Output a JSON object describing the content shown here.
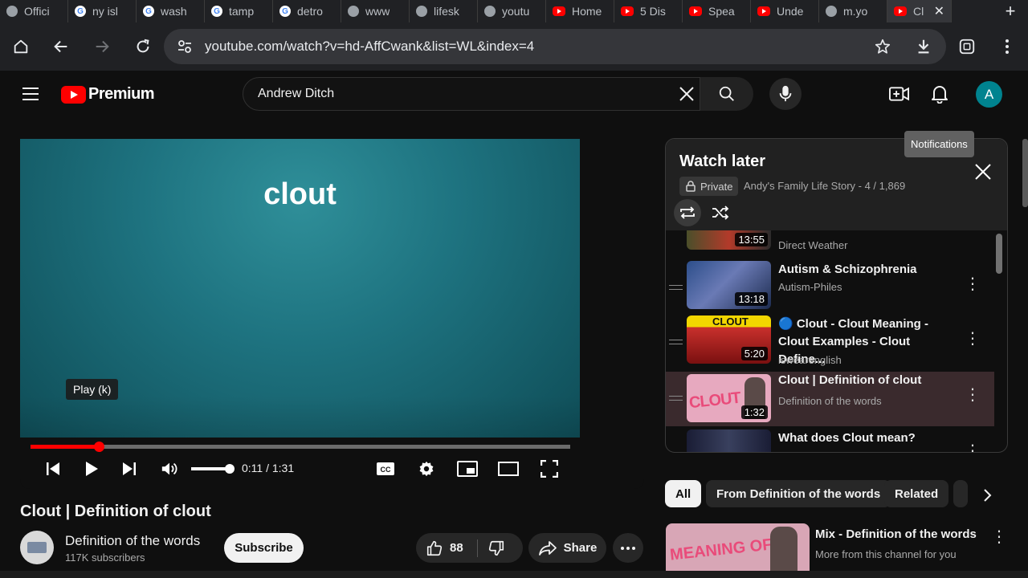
{
  "tabs": [
    {
      "label": "Offici",
      "icon": "globe-icon"
    },
    {
      "label": "ny isl",
      "icon": "google-icon"
    },
    {
      "label": "wash",
      "icon": "google-icon"
    },
    {
      "label": "tamp",
      "icon": "google-icon"
    },
    {
      "label": "detro",
      "icon": "google-icon"
    },
    {
      "label": "www",
      "icon": "globe-icon"
    },
    {
      "label": "lifesk",
      "icon": "globe-icon"
    },
    {
      "label": "youtu",
      "icon": "globe-icon"
    },
    {
      "label": "Home",
      "icon": "youtube-icon"
    },
    {
      "label": "5 Dis",
      "icon": "youtube-icon"
    },
    {
      "label": "Spea",
      "icon": "youtube-icon"
    },
    {
      "label": "Unde",
      "icon": "youtube-icon"
    },
    {
      "label": "m.yo",
      "icon": "globe-icon"
    },
    {
      "label": "Cl",
      "icon": "youtube-icon",
      "active": true
    }
  ],
  "browser": {
    "url": "youtube.com/watch?v=hd-AffCwank&list=WL&index=4"
  },
  "header": {
    "logo_text": "Premium",
    "search_value": "Andrew Ditch",
    "avatar_letter": "A",
    "notifications_tooltip": "Notifications"
  },
  "player": {
    "slide_text": "clout",
    "play_tooltip": "Play (k)",
    "time": "0:11 / 1:31",
    "progress": 0.127,
    "volume": 0.92
  },
  "video": {
    "title": "Clout | Definition of clout",
    "channel": "Definition of the words",
    "subscribers": "117K subscribers",
    "subscribe_label": "Subscribe",
    "likes": "88",
    "share_label": "Share"
  },
  "playlist": {
    "title": "Watch later",
    "privacy": "Private",
    "meta": "Andy's Family Life Story - 4 / 1,869",
    "items": [
      {
        "title": "",
        "channel": "Direct Weather",
        "duration": "13:55"
      },
      {
        "title": "Autism & Schizophrenia",
        "channel": "Autism-Philes",
        "duration": "13:18"
      },
      {
        "title": "🔵 Clout - Clout Meaning - Clout Examples - Clout Define...",
        "channel": "iswearenglish",
        "duration": "5:20",
        "thumb_text": "CLOUT"
      },
      {
        "title": "Clout | Definition of clout",
        "channel": "Definition of the words",
        "duration": "1:32",
        "thumb_text": "CLOUT",
        "current": true
      },
      {
        "title": "What does Clout mean?",
        "channel": "",
        "duration": ""
      }
    ]
  },
  "chips": [
    "All",
    "From Definition of the words",
    "Related"
  ],
  "recommendation": {
    "title": "Mix - Definition of the words",
    "subtitle": "More from this channel for you"
  }
}
